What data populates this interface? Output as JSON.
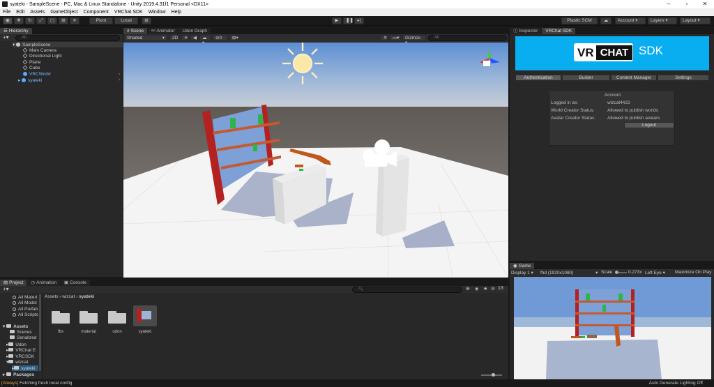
{
  "window": {
    "title": "syateki - SampleScene - PC, Mac & Linux Standalone - Unity 2019.4.31f1 Personal <DX11>"
  },
  "menu": [
    "File",
    "Edit",
    "Assets",
    "GameObject",
    "Component",
    "VRChat SDK",
    "Window",
    "Help"
  ],
  "toolbar": {
    "pivot": "Pivot",
    "local": "Local",
    "plastic": "Plastic SCM",
    "account": "Account",
    "layers": "Layers",
    "layout": "Layout"
  },
  "hierarchy": {
    "tab": "Hierarchy",
    "search_placeholder": "All",
    "scene": "SampleScene",
    "items": [
      "Main Camera",
      "Directional Light",
      "Plane",
      "Cube",
      "VRCWorld",
      "syateki"
    ]
  },
  "scene_view": {
    "tabs": [
      "Scene",
      "Animator",
      "Udon Graph"
    ],
    "shading": "Shaded",
    "mode_2d": "2D",
    "gizmos": "Gizmos",
    "search_placeholder": "All",
    "fx_count": "0"
  },
  "inspector": {
    "tabs": [
      "Inspector",
      "VRChat SDK"
    ],
    "sdk_logo_left": "VR",
    "sdk_logo_mid": "CHAT",
    "sdk_logo_right": "SDK",
    "sdk_tabs": [
      "Authentication",
      "Builder",
      "Content Manager",
      "Settings"
    ],
    "account": {
      "heading": "Account",
      "logged_in_label": "Logged in as:",
      "logged_in_value": "wizcat4423",
      "world_label": "World Creator Status:",
      "world_value": "Allowed to publish worlds",
      "avatar_label": "Avatar Creator Status:",
      "avatar_value": "Allowed to publish avatars",
      "logout": "Logout"
    }
  },
  "game_view": {
    "tab": "Game",
    "display": "Display 1",
    "resolution": "fhd (1920x1080)",
    "scale_label": "Scale",
    "scale_value": "0.273x",
    "eye": "Left Eye",
    "maximize": "Maximize On Play"
  },
  "project": {
    "tabs": [
      "Project",
      "Animation",
      "Console"
    ],
    "favorites": [
      "All Materi",
      "All Model",
      "All Prefab",
      "All Scripts"
    ],
    "assets_root": "Assets",
    "tree": [
      "Scenes",
      "Serialized",
      "Udon",
      "VRChat E",
      "VRCSDK",
      "wizcat",
      "syateki"
    ],
    "packages": "Packages",
    "breadcrumb": [
      "Assets",
      "wizcat",
      "syateki"
    ],
    "folders": [
      "fbx",
      "material",
      "udon",
      "syateki"
    ],
    "count": "13"
  },
  "status": {
    "message_tag": "[Always]",
    "message": " Fetching fresh local config",
    "right": "Auto Generate Lighting Off"
  }
}
